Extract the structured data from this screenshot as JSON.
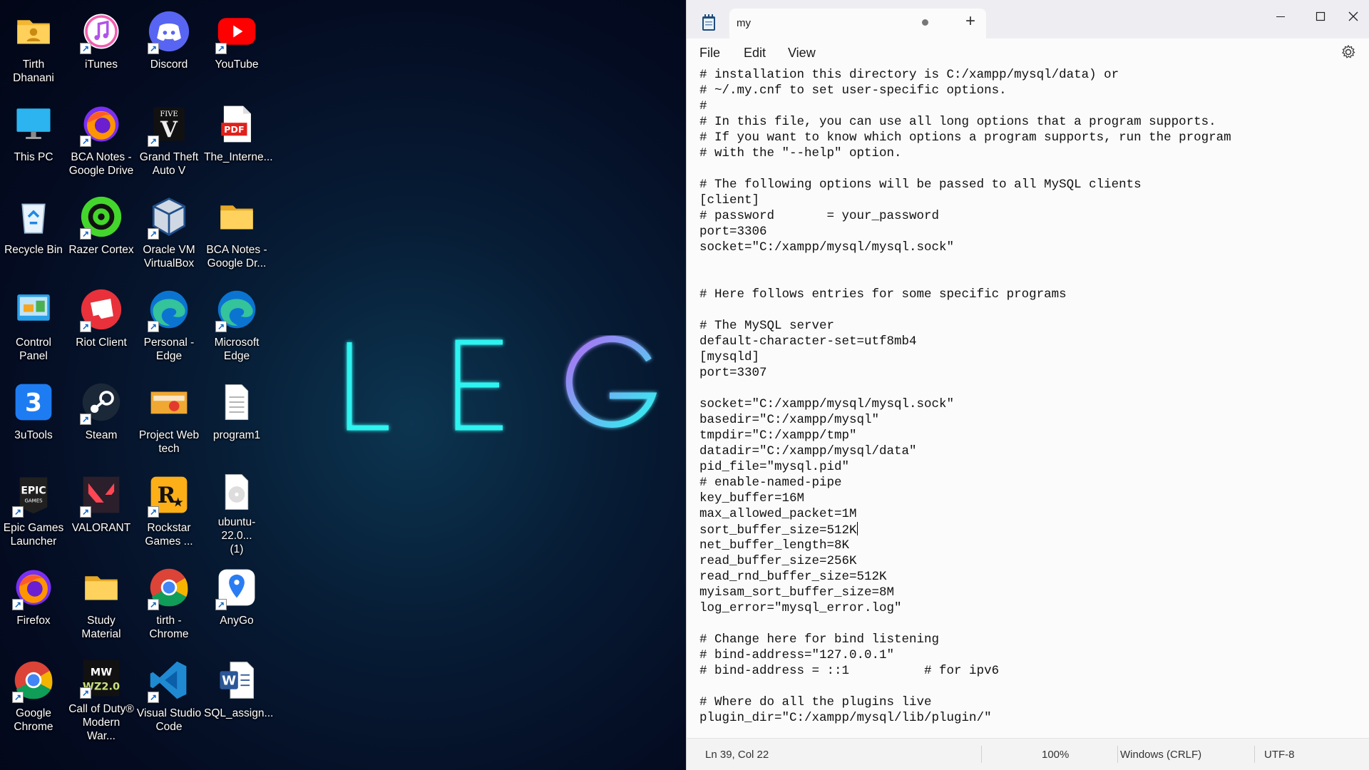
{
  "desktop": {
    "icons": [
      {
        "label": "Tirth Dhanani",
        "icon": "user-folder-icon"
      },
      {
        "label": "iTunes",
        "icon": "itunes-icon"
      },
      {
        "label": "Discord",
        "icon": "discord-icon"
      },
      {
        "label": "YouTube",
        "icon": "youtube-icon"
      },
      {
        "label": "This PC",
        "icon": "monitor-icon"
      },
      {
        "label": "BCA Notes -\nGoogle Drive",
        "icon": "firefox-icon"
      },
      {
        "label": "Grand Theft\nAuto V",
        "icon": "gta-icon"
      },
      {
        "label": "The_Interne...",
        "icon": "pdf-icon"
      },
      {
        "label": "Recycle Bin",
        "icon": "recycle-bin-icon"
      },
      {
        "label": "Razer Cortex",
        "icon": "razer-icon"
      },
      {
        "label": "Oracle VM\nVirtualBox",
        "icon": "virtualbox-icon"
      },
      {
        "label": "BCA Notes -\nGoogle Dr...",
        "icon": "folder-icon"
      },
      {
        "label": "Control Panel",
        "icon": "control-panel-icon"
      },
      {
        "label": "Riot Client",
        "icon": "riot-icon"
      },
      {
        "label": "Personal -\nEdge",
        "icon": "edge-icon"
      },
      {
        "label": "Microsoft\nEdge",
        "icon": "edge-icon"
      },
      {
        "label": "3uTools",
        "icon": "3utools-icon"
      },
      {
        "label": "Steam",
        "icon": "steam-icon"
      },
      {
        "label": "Project Web\ntech",
        "icon": "project-icon"
      },
      {
        "label": "program1",
        "icon": "text-file-icon"
      },
      {
        "label": "Epic Games\nLauncher",
        "icon": "epic-icon"
      },
      {
        "label": "VALORANT",
        "icon": "valorant-icon"
      },
      {
        "label": "Rockstar\nGames ...",
        "icon": "rockstar-icon"
      },
      {
        "label": "ubuntu-22.0...\n(1)",
        "icon": "disc-image-icon"
      },
      {
        "label": "Firefox",
        "icon": "firefox-icon"
      },
      {
        "label": "Study\nMaterial",
        "icon": "folder-icon"
      },
      {
        "label": "tirth -\nChrome",
        "icon": "chrome-icon"
      },
      {
        "label": "AnyGo",
        "icon": "anygo-icon"
      },
      {
        "label": "Google\nChrome",
        "icon": "chrome-icon"
      },
      {
        "label": "Call of Duty®\nModern War...",
        "icon": "cod-icon"
      },
      {
        "label": "Visual Studio\nCode",
        "icon": "vscode-icon"
      },
      {
        "label": "SQL_assign...",
        "icon": "word-icon"
      }
    ],
    "wallpaper_letters": [
      "L",
      "E",
      "G"
    ],
    "colors": {
      "neon_cyan": "#2ff3f0",
      "neon_purple": "#b16cf5"
    }
  },
  "notepad": {
    "tab_title": "my",
    "new_tab": "+",
    "menu": {
      "file": "File",
      "edit": "Edit",
      "view": "View"
    },
    "lines": [
      "# installation this directory is C:/xampp/mysql/data) or",
      "# ~/.my.cnf to set user-specific options.",
      "#",
      "# In this file, you can use all long options that a program supports.",
      "# If you want to know which options a program supports, run the program",
      "# with the \"--help\" option.",
      "",
      "# The following options will be passed to all MySQL clients",
      "[client]",
      "# password       = your_password",
      "port=3306",
      "socket=\"C:/xampp/mysql/mysql.sock\"",
      "",
      "",
      "# Here follows entries for some specific programs",
      "",
      "# The MySQL server",
      "default-character-set=utf8mb4",
      "[mysqld]",
      "port=3307",
      "",
      "socket=\"C:/xampp/mysql/mysql.sock\"",
      "basedir=\"C:/xampp/mysql\"",
      "tmpdir=\"C:/xampp/tmp\"",
      "datadir=\"C:/xampp/mysql/data\"",
      "pid_file=\"mysql.pid\"",
      "# enable-named-pipe",
      "key_buffer=16M",
      "max_allowed_packet=1M",
      "sort_buffer_size=512K",
      "net_buffer_length=8K",
      "read_buffer_size=256K",
      "read_rnd_buffer_size=512K",
      "myisam_sort_buffer_size=8M",
      "log_error=\"mysql_error.log\"",
      "",
      "# Change here for bind listening",
      "# bind-address=\"127.0.0.1\"",
      "# bind-address = ::1          # for ipv6",
      "",
      "# Where do all the plugins live",
      "plugin_dir=\"C:/xampp/mysql/lib/plugin/\""
    ],
    "status": {
      "position": "Ln 39, Col 22",
      "zoom": "100%",
      "line_ending": "Windows (CRLF)",
      "encoding": "UTF-8"
    }
  }
}
